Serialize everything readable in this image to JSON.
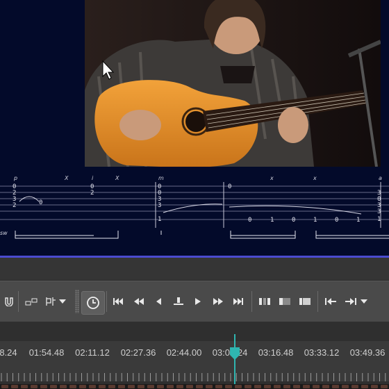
{
  "video": {
    "description_icon": "guitar-performer-video-frame"
  },
  "tablature": {
    "technique_marks": [
      "p",
      "X",
      "i",
      "X",
      "m",
      "x",
      "x",
      "a"
    ],
    "strings_group1": [
      "0",
      "2",
      "3",
      "2"
    ],
    "group1_after": "0",
    "strings_group2": [
      "0",
      "2"
    ],
    "strings_group3": [
      "0",
      "0",
      "3",
      "3",
      "1"
    ],
    "chord_top": "0",
    "run_notes": [
      "0",
      "1",
      "0",
      "1",
      "0",
      "1"
    ],
    "end_notes": [
      "3",
      "0",
      "3",
      "3",
      "1"
    ],
    "left_label": "sw"
  },
  "toolbar": {
    "buttons": [
      "snap-magnet-icon",
      "insert-clip-icon",
      "split-clip-icon",
      "dropdown-icon",
      "clock-icon",
      "go-to-start-icon",
      "rewind-icon",
      "step-back-icon",
      "stop-icon",
      "play-icon",
      "fast-forward-icon",
      "go-to-end-icon",
      "view-1-icon",
      "view-2-icon",
      "view-3-icon",
      "mark-in-icon",
      "mark-out-icon",
      "mark-dropdown-icon"
    ]
  },
  "timeline": {
    "time_labels": [
      "8.24",
      "01:54.48",
      "02:11.12",
      "02:27.36",
      "02:44.00",
      "03:00.24",
      "03:16.48",
      "03:33.12",
      "03:49.36"
    ],
    "playhead_color": "#2fb5b0"
  }
}
